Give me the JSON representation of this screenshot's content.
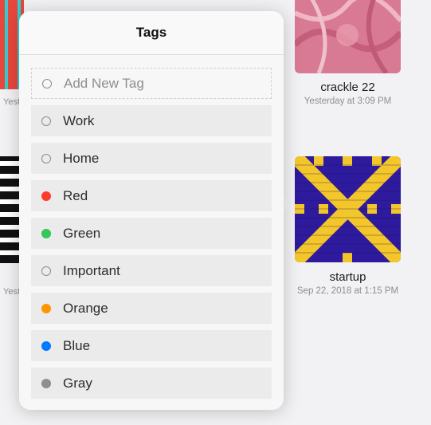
{
  "background_cards": [
    {
      "title": "crackle 22",
      "date": "Yesterday at 3:09 PM"
    },
    {
      "title": "startup",
      "date": "Sep 22, 2018 at 1:15 PM"
    }
  ],
  "popover": {
    "title": "Tags",
    "add_label": "Add New Tag",
    "tags": [
      {
        "label": "Work",
        "color": null
      },
      {
        "label": "Home",
        "color": null
      },
      {
        "label": "Red",
        "color": "#ff3b30"
      },
      {
        "label": "Green",
        "color": "#34c759"
      },
      {
        "label": "Important",
        "color": null
      },
      {
        "label": "Orange",
        "color": "#ff9500"
      },
      {
        "label": "Blue",
        "color": "#007aff"
      },
      {
        "label": "Gray",
        "color": "#8e8e93"
      }
    ]
  },
  "colors": {
    "pattern_purple": "#2e1a9c",
    "pattern_yellow": "#f3c62a",
    "crackle_pink": "#d97a94"
  }
}
